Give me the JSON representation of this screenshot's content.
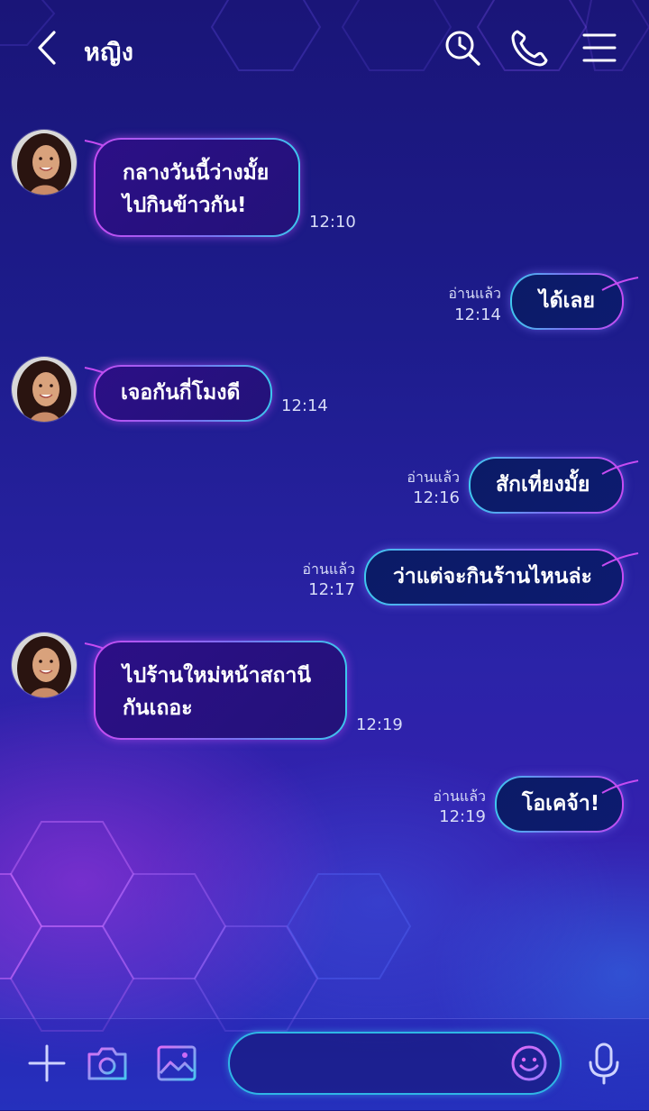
{
  "header": {
    "title": "หญิง",
    "icons": [
      "back-chevron-icon",
      "search-history-icon",
      "phone-icon",
      "menu-icon"
    ]
  },
  "messages": [
    {
      "side": "in",
      "lines": [
        "กลางวันนี้ว่างมั้ย",
        "ไปกินข้าวกัน!"
      ],
      "time": "12:10"
    },
    {
      "side": "out",
      "lines": [
        "ได้เลย"
      ],
      "read": "อ่านแล้ว",
      "time": "12:14"
    },
    {
      "side": "in",
      "lines": [
        "เจอกันกี่โมงดี"
      ],
      "time": "12:14"
    },
    {
      "side": "out",
      "lines": [
        "สักเที่ยงมั้ย"
      ],
      "read": "อ่านแล้ว",
      "time": "12:16"
    },
    {
      "side": "out",
      "lines": [
        "ว่าแต่จะกินร้านไหนล่ะ"
      ],
      "read": "อ่านแล้ว",
      "time": "12:17"
    },
    {
      "side": "in",
      "lines": [
        "ไปร้านใหม่หน้าสถานี",
        "กันเถอะ"
      ],
      "time": "12:19"
    },
    {
      "side": "out",
      "lines": [
        "โอเคจ้า!"
      ],
      "read": "อ่านแล้ว",
      "time": "12:19"
    }
  ],
  "footer": {
    "input_placeholder": "",
    "icons": [
      "plus-icon",
      "camera-icon",
      "image-icon",
      "emoji-icon",
      "microphone-icon"
    ]
  },
  "colors": {
    "background_top": "#1a1578",
    "background_bottom": "#2a3bc8",
    "bubble_border_pink": "#c64cf2",
    "bubble_border_cyan": "#3cc6ee",
    "incoming_fill": "#2c0f86",
    "outgoing_fill": "#0b1b66"
  }
}
